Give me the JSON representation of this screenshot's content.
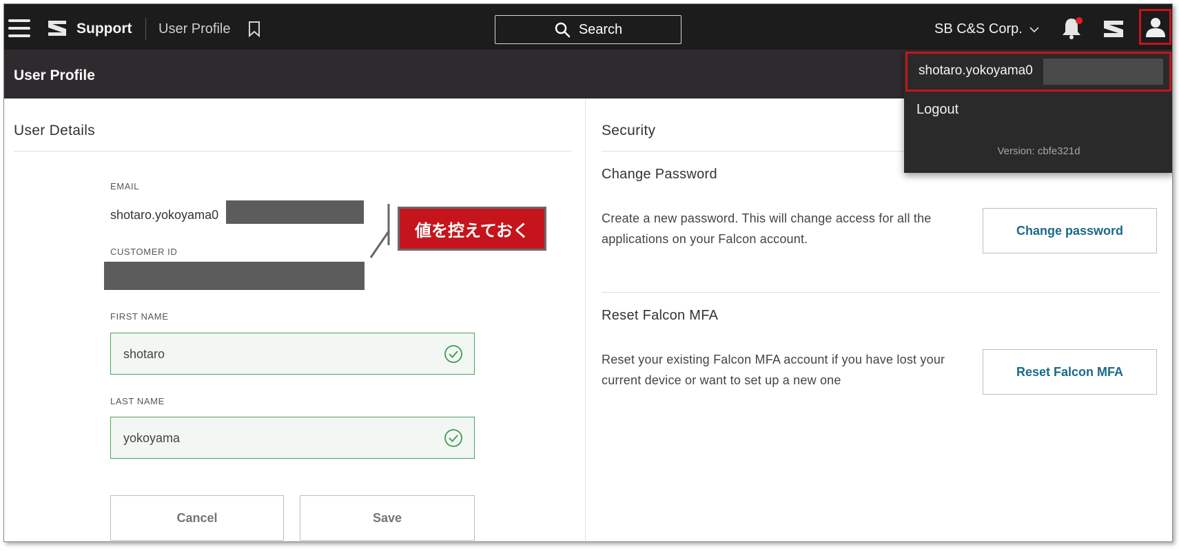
{
  "nav": {
    "brand": "Support",
    "breadcrumb": "User Profile",
    "search_label": "Search",
    "org_name": "SB C&S Corp."
  },
  "page": {
    "title": "User Profile"
  },
  "user_details": {
    "heading": "User Details",
    "email_label": "EMAIL",
    "email_value": "shotaro.yokoyama0",
    "customer_id_label": "CUSTOMER ID",
    "first_name_label": "FIRST NAME",
    "first_name_value": "shotaro",
    "last_name_label": "LAST NAME",
    "last_name_value": "yokoyama",
    "cancel_label": "Cancel",
    "save_label": "Save"
  },
  "annotation": {
    "text": "値を控えておく"
  },
  "security": {
    "heading": "Security",
    "change_password_title": "Change Password",
    "change_password_desc": "Create a new password. This will change access for all the applications on your Falcon account.",
    "change_password_button": "Change password",
    "reset_mfa_title": "Reset Falcon MFA",
    "reset_mfa_desc": "Reset your existing Falcon MFA account if you have lost your current device or want to set up a new one",
    "reset_mfa_button": "Reset Falcon MFA"
  },
  "user_menu": {
    "username": "shotaro.yokoyama0",
    "logout_label": "Logout",
    "version": "Version: cbfe321d"
  },
  "colors": {
    "nav_bg": "#1c1c1c",
    "header_bg": "#2e2a2e",
    "highlight_red": "#c8141c",
    "valid_green": "#4aa35a",
    "link_blue": "#1a6a86"
  },
  "icons": [
    "menu-icon",
    "logo-icon",
    "bookmark-icon",
    "search-icon",
    "chevron-down-icon",
    "bell-icon",
    "apps-icon",
    "user-icon",
    "check-icon"
  ]
}
